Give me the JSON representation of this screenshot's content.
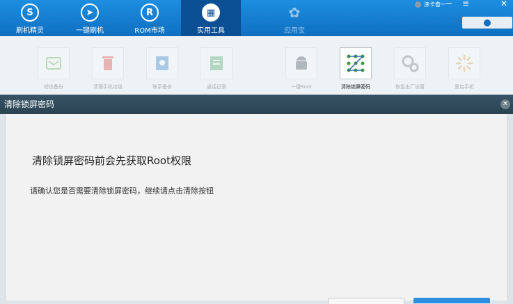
{
  "nav": {
    "items": [
      {
        "label": "刷机精灵",
        "icon": "shield-icon"
      },
      {
        "label": "一键刷机",
        "icon": "cursor-icon"
      },
      {
        "label": "ROM市场",
        "icon": "r-icon"
      },
      {
        "label": "实用工具",
        "icon": "grid-icon"
      },
      {
        "label": "应用宝",
        "icon": "yyb-logo-icon"
      }
    ],
    "active_index": 3,
    "user_name": "涤卡奋一",
    "minimize": "−",
    "menu": "≡",
    "close": "✕"
  },
  "tools": {
    "items": [
      {
        "label": "短信备份",
        "icon": "sms-icon"
      },
      {
        "label": "清理手机垃圾",
        "icon": "trash-icon"
      },
      {
        "label": "联系备份",
        "icon": "contacts-icon"
      },
      {
        "label": "通话记录",
        "icon": "call-log-icon"
      },
      {
        "label": "一键Root",
        "icon": "android-icon"
      },
      {
        "label": "清除锁屏密码",
        "icon": "pattern-lock-icon"
      },
      {
        "label": "恢复出厂设置",
        "icon": "gears-icon"
      },
      {
        "label": "重启手机",
        "icon": "loading-icon"
      }
    ],
    "active_index": 5
  },
  "dialog": {
    "title": "清除锁屏密码",
    "close": "✕",
    "heading": "清除锁屏密码前会先获取Root权限",
    "description": "请确认您是否需要清除锁屏密码，继续请点击清除按钮"
  },
  "colors": {
    "nav_bg": "#1577cf",
    "nav_active": "#0b4f94",
    "dialog_title_bg": "#2f4a5a",
    "primary_button": "#2d8fe0"
  }
}
